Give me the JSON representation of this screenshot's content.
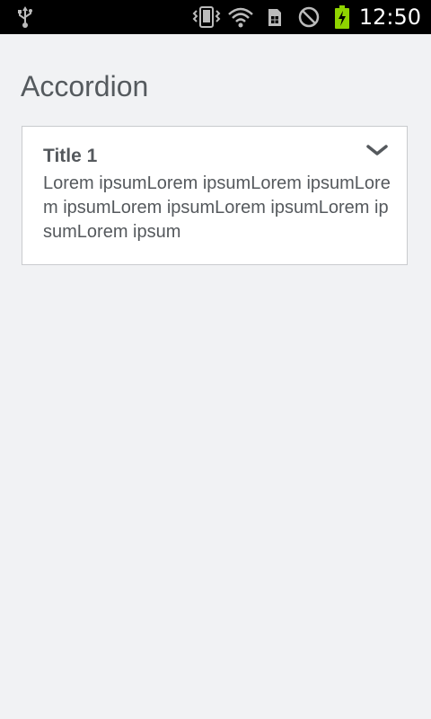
{
  "status_bar": {
    "time": "12:50",
    "icons": [
      "usb-icon",
      "vibrate-icon",
      "wifi-icon",
      "sim-card-icon",
      "do-not-disturb-icon",
      "battery-charging-icon"
    ],
    "battery_color": "#8fd400"
  },
  "page": {
    "title": "Accordion"
  },
  "accordion": {
    "items": [
      {
        "title": "Title 1",
        "content": "Lorem ipsumLorem ipsumLorem ipsumLorem ipsumLorem ipsumLorem ipsumLorem ipsumLorem ipsum",
        "expanded": true
      }
    ]
  }
}
